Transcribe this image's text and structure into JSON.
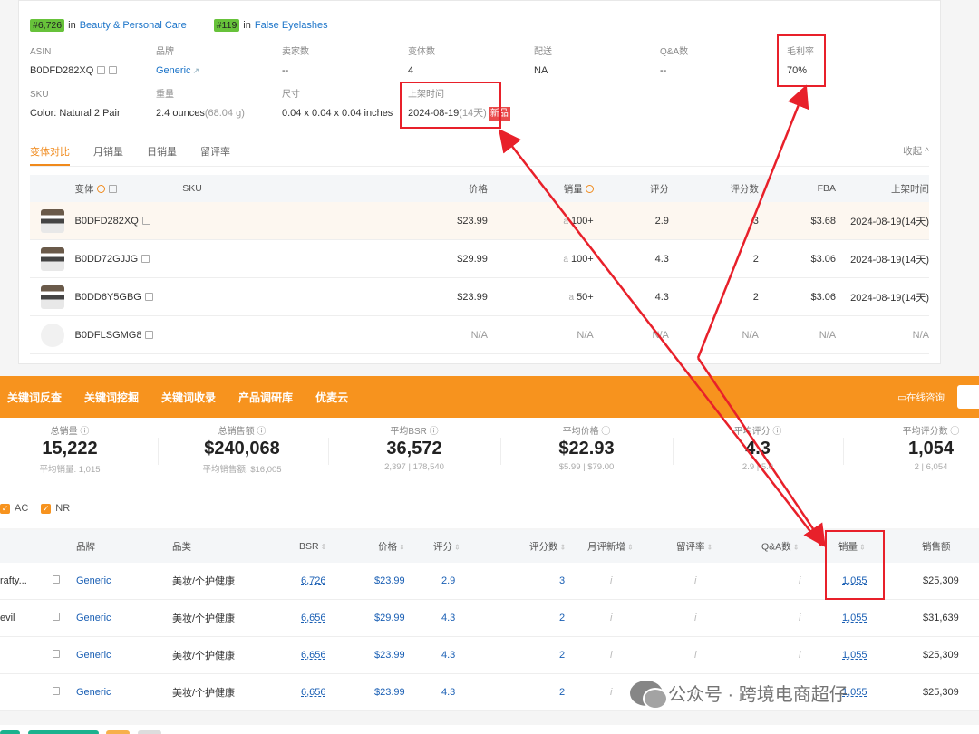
{
  "card": {
    "rank1": {
      "badge": "#6,726",
      "in": "in",
      "category": "Beauty & Personal Care"
    },
    "rank2": {
      "badge": "#119",
      "in": "in",
      "category": "False Eyelashes"
    },
    "info": {
      "asin_label": "ASIN",
      "asin_value": "B0DFD282XQ",
      "brand_label": "品牌",
      "brand_value": "Generic",
      "sellers_label": "卖家数",
      "sellers_value": "--",
      "variants_label": "变体数",
      "variants_value": "4",
      "delivery_label": "配送",
      "delivery_value": "NA",
      "qa_label": "Q&A数",
      "qa_value": "--",
      "margin_label": "毛利率",
      "margin_value": "70%",
      "sku_label": "SKU",
      "sku_value": "Color: Natural 2 Pair",
      "weight_label": "重量",
      "weight_value": "2.4 ounces",
      "weight_sub": "(68.04 g)",
      "size_label": "尺寸",
      "size_value": "0.04 x 0.04 x 0.04 inches",
      "listed_label": "上架时间",
      "listed_value": "2024-08-19",
      "listed_sub": "(14天)",
      "new_tag": "新品"
    },
    "tabs": [
      "变体对比",
      "月销量",
      "日销量",
      "留评率"
    ],
    "collapse_label": "收起 ^",
    "variant_table": {
      "headers": {
        "variant": "变体",
        "sku": "SKU",
        "price": "价格",
        "sales": "销量",
        "rating": "评分",
        "reviews": "评分数",
        "fba": "FBA",
        "listed": "上架时间"
      },
      "rows": [
        {
          "asin": "B0DFD282XQ",
          "price": "$23.99",
          "sales": "100+",
          "rating": "2.9",
          "reviews": "3",
          "fba": "$3.68",
          "listed": "2024-08-19",
          "listed_sub": "(14天)"
        },
        {
          "asin": "B0DD72GJJG",
          "price": "$29.99",
          "sales": "100+",
          "rating": "4.3",
          "reviews": "2",
          "fba": "$3.06",
          "listed": "2024-08-19",
          "listed_sub": "(14天)"
        },
        {
          "asin": "B0DD6Y5GBG",
          "price": "$23.99",
          "sales": "50+",
          "rating": "4.3",
          "reviews": "2",
          "fba": "$3.06",
          "listed": "2024-08-19",
          "listed_sub": "(14天)"
        },
        {
          "asin": "B0DFLSGMG8",
          "price": "N/A",
          "sales": "N/A",
          "rating": "N/A",
          "reviews": "N/A",
          "fba": "N/A",
          "listed": "N/A",
          "listed_sub": ""
        }
      ]
    }
  },
  "toolbar": {
    "items": [
      "关键词反查",
      "关键词挖掘",
      "关键词收录",
      "产品调研库",
      "优麦云"
    ],
    "online": "在线咨询"
  },
  "stats": [
    {
      "label": "总销量",
      "value": "15,222",
      "sub": "平均销量: 1,015"
    },
    {
      "label": "总销售额",
      "value": "$240,068",
      "sub": "平均销售额: $16,005"
    },
    {
      "label": "平均BSR",
      "value": "36,572",
      "sub": "2,397 | 178,540"
    },
    {
      "label": "平均价格",
      "value": "$22.93",
      "sub": "$5.99 | $79.00"
    },
    {
      "label": "平均评分",
      "value": "4.3",
      "sub": "2.9 | 5.0"
    },
    {
      "label": "平均评分数",
      "value": "1,054",
      "sub": "2 | 6,054"
    }
  ],
  "filters": [
    {
      "label": "AC"
    },
    {
      "label": "NR"
    }
  ],
  "product_table": {
    "headers": {
      "brand": "品牌",
      "category": "品类",
      "bsr": "BSR",
      "price": "价格",
      "rating": "评分",
      "reviews": "评分数",
      "monthly_new": "月评新增",
      "review_rate": "留评率",
      "qa": "Q&A数",
      "sales": "销量",
      "revenue": "销售额"
    },
    "rows": [
      {
        "title": "rafty...",
        "brand": "Generic",
        "category": "美妆/个护健康",
        "bsr": "6,726",
        "price": "$23.99",
        "rating": "2.9",
        "reviews": "3",
        "monthly_new": "i",
        "review_rate": "i",
        "qa": "i",
        "sales": "1,055",
        "revenue": "$25,309"
      },
      {
        "title": "evil",
        "brand": "Generic",
        "category": "美妆/个护健康",
        "bsr": "6,656",
        "price": "$29.99",
        "rating": "4.3",
        "reviews": "2",
        "monthly_new": "i",
        "review_rate": "i",
        "qa": "i",
        "sales": "1,055",
        "revenue": "$31,639"
      },
      {
        "title": "",
        "brand": "Generic",
        "category": "美妆/个护健康",
        "bsr": "6,656",
        "price": "$23.99",
        "rating": "4.3",
        "reviews": "2",
        "monthly_new": "i",
        "review_rate": "i",
        "qa": "i",
        "sales": "1,055",
        "revenue": "$25,309"
      },
      {
        "title": "",
        "brand": "Generic",
        "category": "美妆/个护健康",
        "bsr": "6,656",
        "price": "$23.99",
        "rating": "4.3",
        "reviews": "2",
        "monthly_new": "i",
        "review_rate": "i",
        "qa": "i",
        "sales": "1,055",
        "revenue": "$25,309"
      }
    ]
  },
  "watermark": "公众号 · 跨境电商超仔",
  "colors": {
    "accent": "#f7931e",
    "annotation": "#e8202a",
    "link": "#1a5fb4",
    "rank_badge": "#67c23a"
  }
}
